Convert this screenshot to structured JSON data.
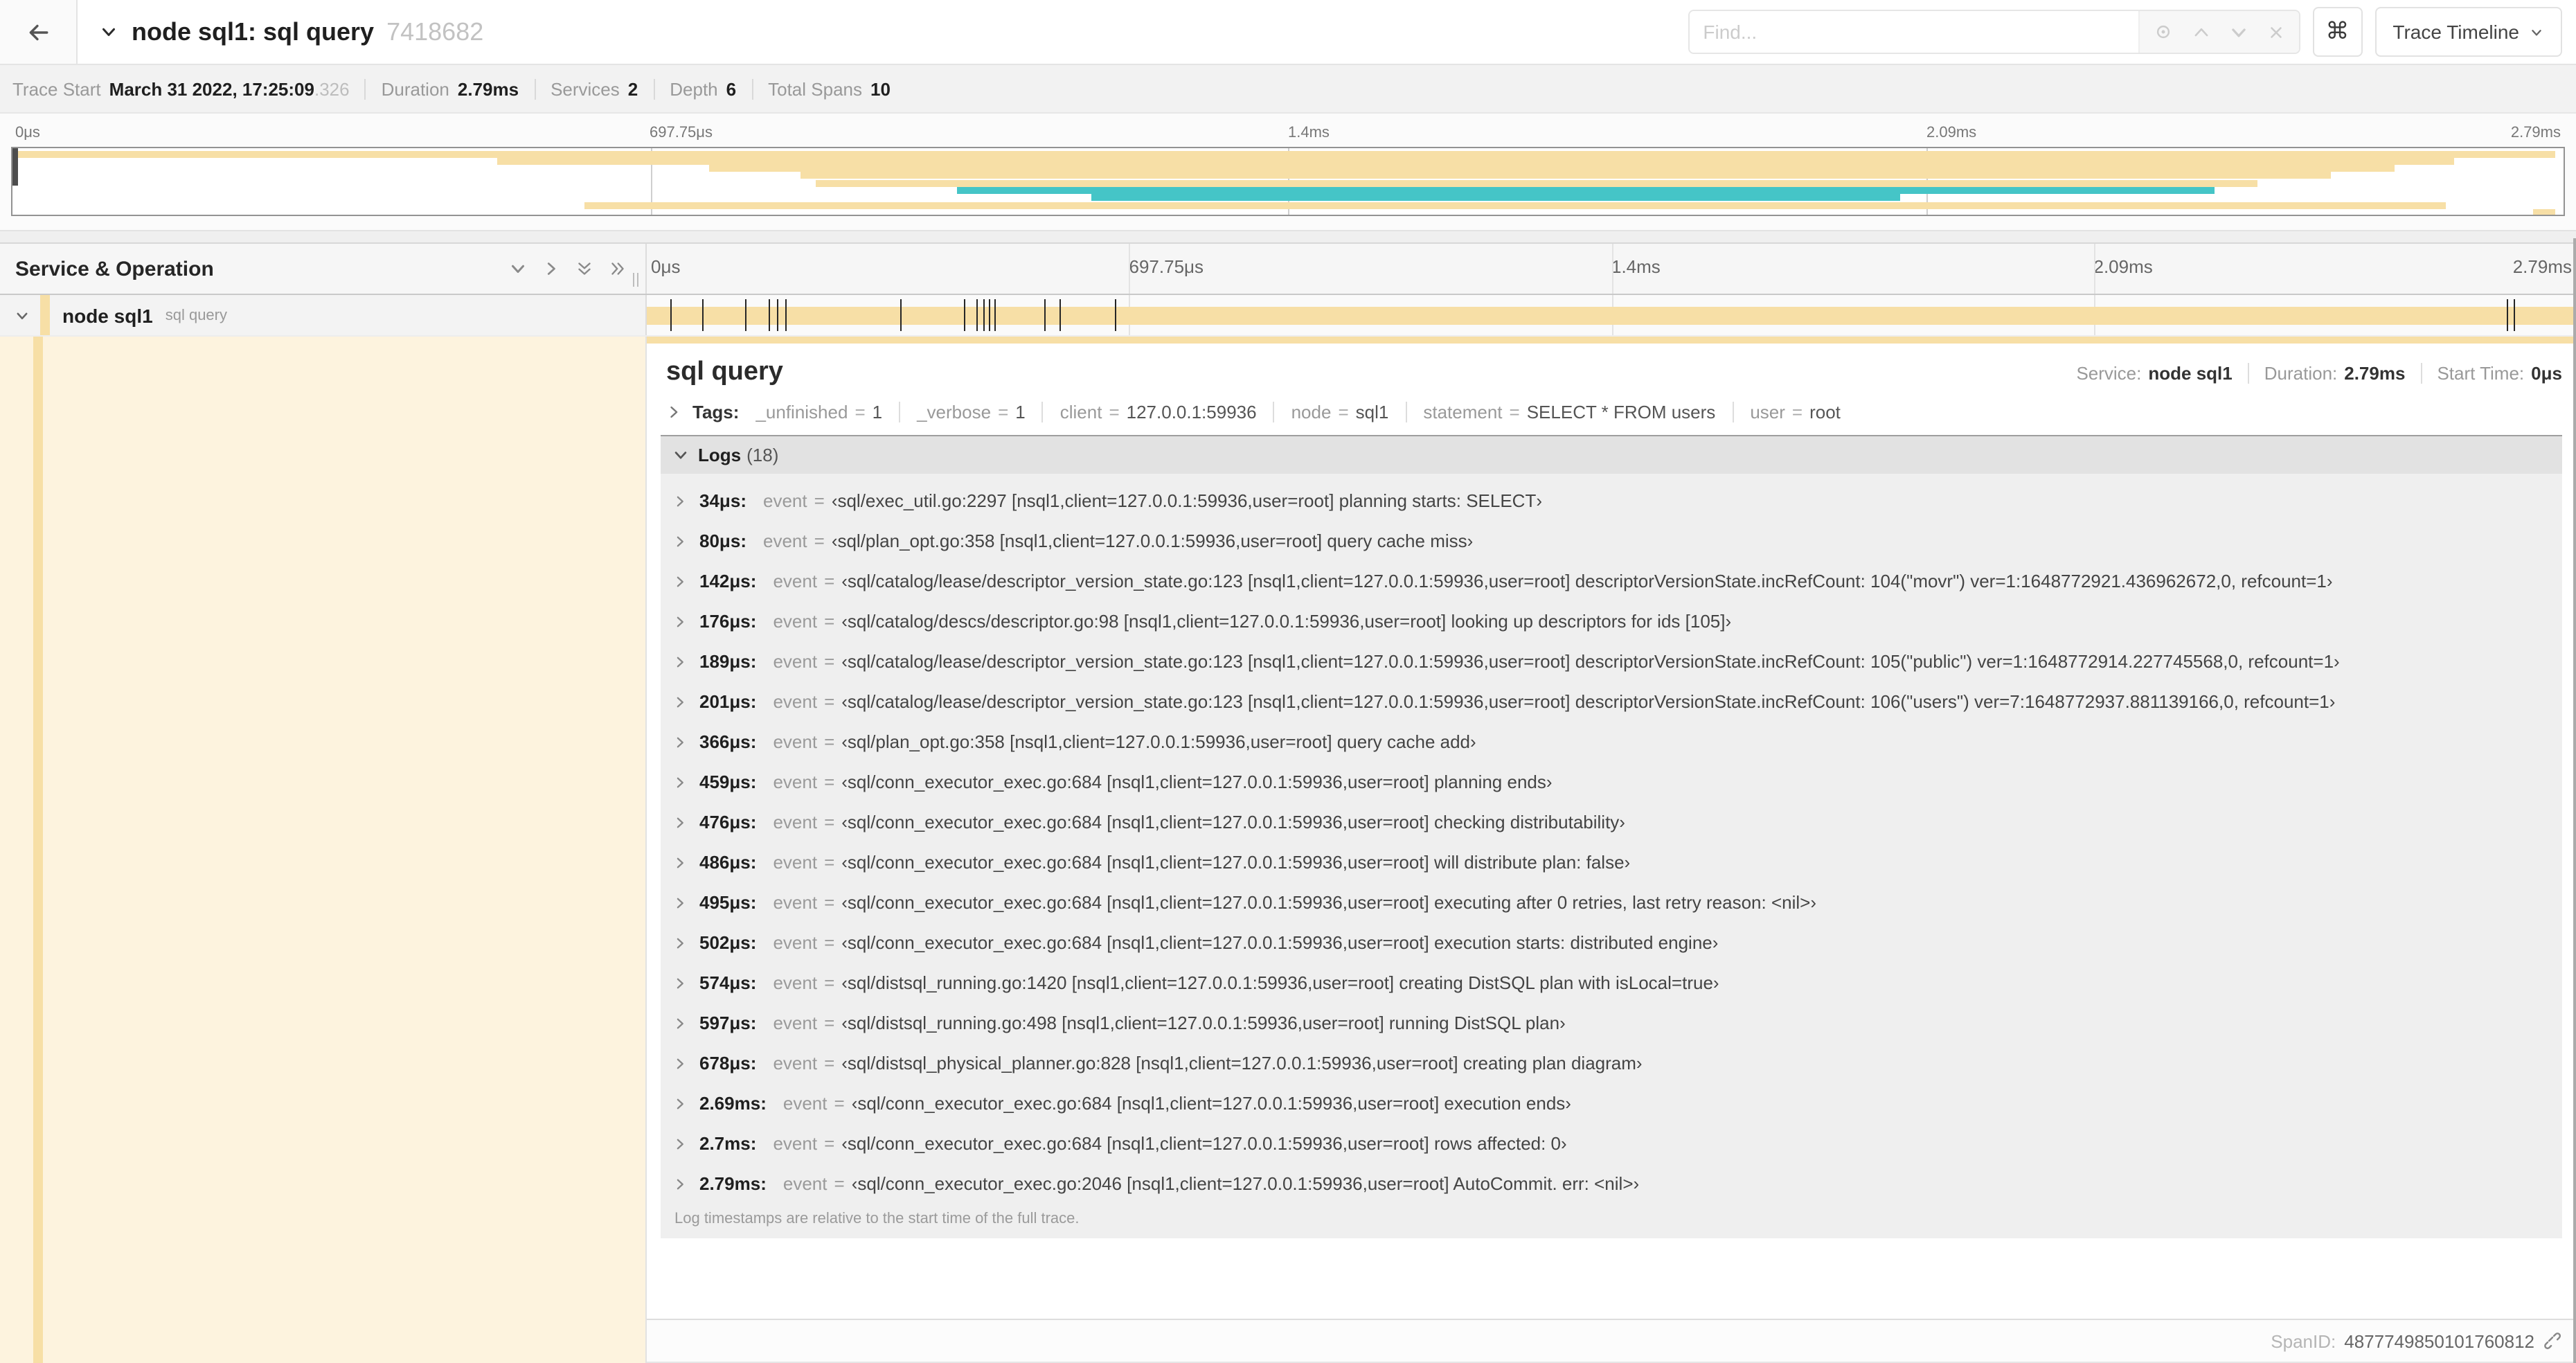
{
  "colors": {
    "tan": "#F7DFA6",
    "teal": "#45C5C7",
    "dark_tick": "#262626"
  },
  "header": {
    "title": "node sql1: sql query",
    "trace_id_short": "7418682",
    "find_placeholder": "Find...",
    "shortcut_key": "⌘",
    "view_selector_label": "Trace Timeline"
  },
  "trace_info": {
    "items": [
      {
        "label": "Trace Start",
        "value": "March 31 2022, 17:25:09",
        "suffix": ".326"
      },
      {
        "label": "Duration",
        "value": "2.79ms"
      },
      {
        "label": "Services",
        "value": "2"
      },
      {
        "label": "Depth",
        "value": "6"
      },
      {
        "label": "Total Spans",
        "value": "10"
      }
    ]
  },
  "timeline": {
    "gridlines": [
      25,
      50,
      75
    ],
    "ticks": [
      {
        "label": "0μs",
        "pos": 0
      },
      {
        "label": "697.75μs",
        "pos": 25
      },
      {
        "label": "1.4ms",
        "pos": 50
      },
      {
        "label": "2.09ms",
        "pos": 75
      },
      {
        "label": "2.79ms",
        "pos": 100
      }
    ]
  },
  "minimap": {
    "spans": [
      {
        "row": 0,
        "start": 0,
        "end": 99.7,
        "color": "tan"
      },
      {
        "row": 1,
        "start": 19.0,
        "end": 95.7,
        "color": "tan"
      },
      {
        "row": 2,
        "start": 27.3,
        "end": 93.4,
        "color": "tan"
      },
      {
        "row": 3,
        "start": 30.9,
        "end": 90.9,
        "color": "tan"
      },
      {
        "row": 4,
        "start": 31.5,
        "end": 88.0,
        "color": "tan"
      },
      {
        "row": 5,
        "start": 37.0,
        "end": 86.3,
        "color": "teal"
      },
      {
        "row": 6,
        "start": 42.3,
        "end": 74.0,
        "color": "teal"
      },
      {
        "row": 7,
        "start": 22.4,
        "end": 95.4,
        "color": "tan"
      },
      {
        "row": 8,
        "start": 98.8,
        "end": 99.7,
        "color": "tan"
      }
    ]
  },
  "service_operation": {
    "column_title": "Service & Operation"
  },
  "span_row": {
    "service": "node sql1",
    "operation": "sql query",
    "tick_positions": [
      1.22,
      2.87,
      5.09,
      6.31,
      6.77,
      7.2,
      13.12,
      16.45,
      17.06,
      17.42,
      17.74,
      18.0,
      20.57,
      21.4,
      24.3,
      96.42,
      96.77,
      99.9
    ]
  },
  "detail": {
    "title": "sql query",
    "meta": [
      {
        "label": "Service:",
        "value": "node sql1"
      },
      {
        "label": "Duration:",
        "value": "2.79ms"
      },
      {
        "label": "Start Time:",
        "value": "0μs"
      }
    ],
    "tags": {
      "label": "Tags:",
      "items": [
        {
          "key": "_unfinished",
          "value": "1"
        },
        {
          "key": "_verbose",
          "value": "1"
        },
        {
          "key": "client",
          "value": "127.0.0.1:59936"
        },
        {
          "key": "node",
          "value": "sql1"
        },
        {
          "key": "statement",
          "value": "SELECT * FROM users"
        },
        {
          "key": "user",
          "value": "root"
        }
      ]
    },
    "logs": {
      "label": "Logs",
      "count": "(18)",
      "entries": [
        {
          "time": "34μs",
          "key": "event",
          "value": "‹sql/exec_util.go:2297 [nsql1,client=127.0.0.1:59936,user=root] planning starts: SELECT›"
        },
        {
          "time": "80μs",
          "key": "event",
          "value": "‹sql/plan_opt.go:358 [nsql1,client=127.0.0.1:59936,user=root] query cache miss›"
        },
        {
          "time": "142μs",
          "key": "event",
          "value": "‹sql/catalog/lease/descriptor_version_state.go:123 [nsql1,client=127.0.0.1:59936,user=root] descriptorVersionState.incRefCount: 104(\"movr\") ver=1:1648772921.436962672,0, refcount=1›"
        },
        {
          "time": "176μs",
          "key": "event",
          "value": "‹sql/catalog/descs/descriptor.go:98 [nsql1,client=127.0.0.1:59936,user=root] looking up descriptors for ids [105]›"
        },
        {
          "time": "189μs",
          "key": "event",
          "value": "‹sql/catalog/lease/descriptor_version_state.go:123 [nsql1,client=127.0.0.1:59936,user=root] descriptorVersionState.incRefCount: 105(\"public\") ver=1:1648772914.227745568,0, refcount=1›"
        },
        {
          "time": "201μs",
          "key": "event",
          "value": "‹sql/catalog/lease/descriptor_version_state.go:123 [nsql1,client=127.0.0.1:59936,user=root] descriptorVersionState.incRefCount: 106(\"users\") ver=7:1648772937.881139166,0, refcount=1›"
        },
        {
          "time": "366μs",
          "key": "event",
          "value": "‹sql/plan_opt.go:358 [nsql1,client=127.0.0.1:59936,user=root] query cache add›"
        },
        {
          "time": "459μs",
          "key": "event",
          "value": "‹sql/conn_executor_exec.go:684 [nsql1,client=127.0.0.1:59936,user=root] planning ends›"
        },
        {
          "time": "476μs",
          "key": "event",
          "value": "‹sql/conn_executor_exec.go:684 [nsql1,client=127.0.0.1:59936,user=root] checking distributability›"
        },
        {
          "time": "486μs",
          "key": "event",
          "value": "‹sql/conn_executor_exec.go:684 [nsql1,client=127.0.0.1:59936,user=root] will distribute plan: false›"
        },
        {
          "time": "495μs",
          "key": "event",
          "value": "‹sql/conn_executor_exec.go:684 [nsql1,client=127.0.0.1:59936,user=root] executing after 0 retries, last retry reason: <nil>›"
        },
        {
          "time": "502μs",
          "key": "event",
          "value": "‹sql/conn_executor_exec.go:684 [nsql1,client=127.0.0.1:59936,user=root] execution starts: distributed engine›"
        },
        {
          "time": "574μs",
          "key": "event",
          "value": "‹sql/distsql_running.go:1420 [nsql1,client=127.0.0.1:59936,user=root] creating DistSQL plan with isLocal=true›"
        },
        {
          "time": "597μs",
          "key": "event",
          "value": "‹sql/distsql_running.go:498 [nsql1,client=127.0.0.1:59936,user=root] running DistSQL plan›"
        },
        {
          "time": "678μs",
          "key": "event",
          "value": "‹sql/distsql_physical_planner.go:828 [nsql1,client=127.0.0.1:59936,user=root] creating plan diagram›"
        },
        {
          "time": "2.69ms",
          "key": "event",
          "value": "‹sql/conn_executor_exec.go:684 [nsql1,client=127.0.0.1:59936,user=root] execution ends›"
        },
        {
          "time": "2.7ms",
          "key": "event",
          "value": "‹sql/conn_executor_exec.go:684 [nsql1,client=127.0.0.1:59936,user=root] rows affected: 0›"
        },
        {
          "time": "2.79ms",
          "key": "event",
          "value": "‹sql/conn_executor_exec.go:2046 [nsql1,client=127.0.0.1:59936,user=root] AutoCommit. err: <nil>›"
        }
      ],
      "footer": "Log timestamps are relative to the start time of the full trace."
    },
    "span_id_label": "SpanID:",
    "span_id": "4877749850101760812"
  }
}
